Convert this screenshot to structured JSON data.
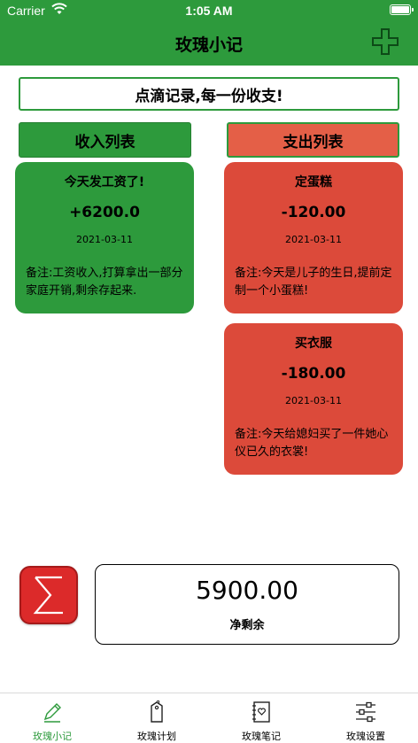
{
  "status_bar": {
    "carrier": "Carrier",
    "time": "1:05 AM"
  },
  "nav": {
    "title": "玫瑰小记",
    "add_icon": "plus-icon"
  },
  "slogan": "点滴记录,每一份收支!",
  "tabs": {
    "income": "收入列表",
    "expense": "支出列表"
  },
  "income_records": [
    {
      "title": "今天发工资了!",
      "amount": "+6200.0",
      "date": "2021-03-11",
      "note": "备注:工资收入,打算拿出一部分家庭开销,剩余存起来."
    }
  ],
  "expense_records": [
    {
      "title": "定蛋糕",
      "amount": "-120.00",
      "date": "2021-03-11",
      "note": "备注:今天是儿子的生日,提前定制一个小蛋糕!"
    },
    {
      "title": "买衣服",
      "amount": "-180.00",
      "date": "2021-03-11",
      "note": "备注:今天给媳妇买了一件她心仪已久的衣裳!"
    }
  ],
  "summary": {
    "total": "5900.00",
    "label": "净剩余",
    "icon": "sigma-icon"
  },
  "tabbar": [
    {
      "label": "玫瑰小记",
      "icon": "pencil-icon",
      "active": true
    },
    {
      "label": "玫瑰计划",
      "icon": "tag-icon",
      "active": false
    },
    {
      "label": "玫瑰笔记",
      "icon": "notebook-icon",
      "active": false
    },
    {
      "label": "玫瑰设置",
      "icon": "sliders-icon",
      "active": false
    }
  ],
  "colors": {
    "brand_green": "#2d9a3c",
    "expense_red": "#dc4a3a",
    "expense_tab": "#e45f47",
    "sigma_red": "#dc2a2a"
  }
}
